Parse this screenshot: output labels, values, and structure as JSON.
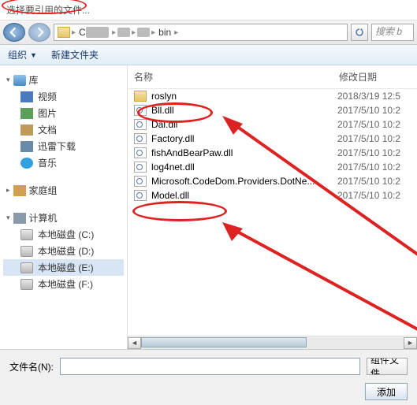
{
  "title": "选择要引用的文件...",
  "breadcrumb": {
    "seg_bin": "bin"
  },
  "search_placeholder": "搜索 b",
  "toolbar": {
    "organize": "组织",
    "newfolder": "新建文件夹"
  },
  "sidebar": {
    "lib": "库",
    "lib_items": [
      "视频",
      "图片",
      "文档",
      "迅雷下载",
      "音乐"
    ],
    "home": "家庭组",
    "pc": "计算机",
    "drives": [
      "本地磁盘 (C:)",
      "本地磁盘 (D:)",
      "本地磁盘 (E:)",
      "本地磁盘 (F:)"
    ]
  },
  "columns": {
    "name": "名称",
    "date": "修改日期"
  },
  "files": [
    {
      "name": "roslyn",
      "type": "folder",
      "date": "2018/3/19 12:5"
    },
    {
      "name": "Bll.dll",
      "type": "dll",
      "date": "2017/5/10 10:2"
    },
    {
      "name": "Dal.dll",
      "type": "dll",
      "date": "2017/5/10 10:2"
    },
    {
      "name": "Factory.dll",
      "type": "dll",
      "date": "2017/5/10 10:2"
    },
    {
      "name": "fishAndBearPaw.dll",
      "type": "dll",
      "date": "2017/5/10 10:2"
    },
    {
      "name": "log4net.dll",
      "type": "dll",
      "date": "2017/5/10 10:2"
    },
    {
      "name": "Microsoft.CodeDom.Providers.DotNe...",
      "type": "dll",
      "date": "2017/5/10 10:2"
    },
    {
      "name": "Model.dll",
      "type": "dll",
      "date": "2017/5/10 10:2"
    }
  ],
  "filename_label": "文件名(N):",
  "filter_label": "组件文件",
  "add_button": "添加"
}
